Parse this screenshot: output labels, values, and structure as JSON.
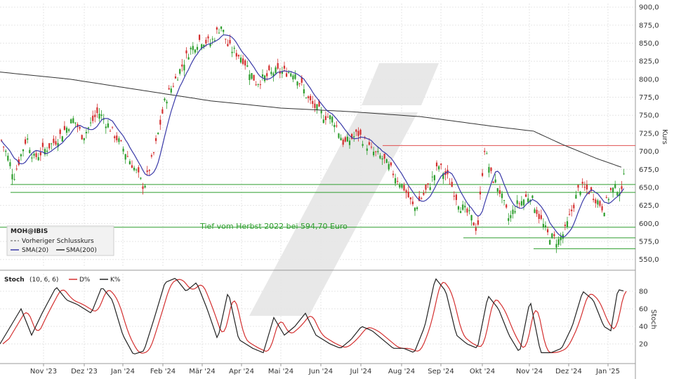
{
  "chart_data": [
    {
      "type": "candlestick",
      "ylabel": "Kurs",
      "ylim": [
        540,
        905
      ],
      "yticks": [
        550,
        575,
        600,
        625,
        650,
        675,
        700,
        725,
        750,
        775,
        800,
        825,
        850,
        875,
        900
      ],
      "ytick_labels": [
        "550,0",
        "575,0",
        "600,0",
        "625,0",
        "650,0",
        "675,0",
        "700,0",
        "725,0",
        "750,0",
        "775,0",
        "800,0",
        "825,0",
        "850,0",
        "875,0",
        "900,0"
      ],
      "x_months": [
        "Nov '23",
        "Dez '23",
        "Jan '24",
        "Feb '24",
        "Mär '24",
        "Apr '24",
        "Mai '24",
        "Jun '24",
        "Jul '24",
        "Aug '24",
        "Sep '24",
        "Okt '24",
        "Nov '24",
        "Dez '24",
        "Jan '25"
      ],
      "close_anchors": [
        [
          0,
          720
        ],
        [
          12,
          690
        ],
        [
          20,
          665
        ],
        [
          38,
          720
        ],
        [
          48,
          690
        ],
        [
          80,
          715
        ],
        [
          105,
          745
        ],
        [
          118,
          720
        ],
        [
          140,
          755
        ],
        [
          155,
          735
        ],
        [
          175,
          705
        ],
        [
          195,
          670
        ],
        [
          205,
          650
        ],
        [
          220,
          700
        ],
        [
          235,
          770
        ],
        [
          255,
          810
        ],
        [
          270,
          840
        ],
        [
          285,
          855
        ],
        [
          300,
          850
        ],
        [
          315,
          875
        ],
        [
          325,
          845
        ],
        [
          345,
          830
        ],
        [
          365,
          795
        ],
        [
          390,
          810
        ],
        [
          420,
          810
        ],
        [
          440,
          770
        ],
        [
          460,
          750
        ],
        [
          475,
          745
        ],
        [
          490,
          710
        ],
        [
          510,
          725
        ],
        [
          530,
          700
        ],
        [
          545,
          690
        ],
        [
          560,
          670
        ],
        [
          575,
          650
        ],
        [
          590,
          620
        ],
        [
          610,
          650
        ],
        [
          625,
          680
        ],
        [
          640,
          660
        ],
        [
          655,
          625
        ],
        [
          670,
          610
        ],
        [
          680,
          590
        ],
        [
          690,
          705
        ],
        [
          700,
          665
        ],
        [
          710,
          650
        ],
        [
          725,
          605
        ],
        [
          735,
          625
        ],
        [
          755,
          640
        ],
        [
          770,
          605
        ],
        [
          780,
          585
        ],
        [
          795,
          575
        ],
        [
          805,
          590
        ],
        [
          815,
          620
        ],
        [
          825,
          650
        ],
        [
          840,
          645
        ],
        [
          860,
          620
        ],
        [
          870,
          645
        ],
        [
          880,
          650
        ],
        [
          886,
          640
        ],
        [
          890,
          695
        ]
      ],
      "annotation": "Tief vom Herbst 2022 bei 594,70 Euro",
      "horizontal_lines": [
        {
          "value": 708,
          "color": "#e05050"
        },
        {
          "value": 654,
          "color": "#2e9e2e"
        },
        {
          "value": 643,
          "color": "#2e9e2e"
        },
        {
          "value": 594.7,
          "color": "#2e9e2e"
        },
        {
          "value": 580,
          "color": "#2e9e2e"
        },
        {
          "value": 565,
          "color": "#2e9e2e"
        }
      ],
      "legend": {
        "title": "MOH@IBIS",
        "items": [
          "Vorheriger Schlusskurs",
          "SMA(20)",
          "SMA(200)"
        ]
      },
      "colors": {
        "up": "#2e9e2e",
        "down": "#d43030",
        "sma20": "#3a3aa8",
        "sma200": "#333333"
      }
    },
    {
      "type": "line",
      "title": "Stoch",
      "params": "(10, 6, 6)",
      "ylabel": "Stoch",
      "ylim": [
        0,
        100
      ],
      "yticks": [
        20,
        40,
        60,
        80
      ],
      "series": [
        {
          "name": "D%",
          "color": "#d43030"
        },
        {
          "name": "K%",
          "color": "#222222"
        }
      ],
      "k_anchors": [
        [
          0,
          20
        ],
        [
          15,
          40
        ],
        [
          30,
          60
        ],
        [
          45,
          30
        ],
        [
          60,
          55
        ],
        [
          80,
          85
        ],
        [
          95,
          70
        ],
        [
          110,
          65
        ],
        [
          130,
          55
        ],
        [
          145,
          85
        ],
        [
          160,
          70
        ],
        [
          175,
          30
        ],
        [
          190,
          8
        ],
        [
          205,
          12
        ],
        [
          220,
          50
        ],
        [
          235,
          90
        ],
        [
          250,
          95
        ],
        [
          265,
          80
        ],
        [
          280,
          90
        ],
        [
          295,
          60
        ],
        [
          310,
          25
        ],
        [
          325,
          80
        ],
        [
          340,
          25
        ],
        [
          360,
          15
        ],
        [
          375,
          10
        ],
        [
          390,
          50
        ],
        [
          405,
          30
        ],
        [
          420,
          40
        ],
        [
          435,
          55
        ],
        [
          450,
          30
        ],
        [
          470,
          20
        ],
        [
          485,
          15
        ],
        [
          500,
          25
        ],
        [
          515,
          40
        ],
        [
          530,
          35
        ],
        [
          545,
          25
        ],
        [
          560,
          15
        ],
        [
          575,
          15
        ],
        [
          590,
          10
        ],
        [
          605,
          40
        ],
        [
          620,
          95
        ],
        [
          635,
          80
        ],
        [
          650,
          30
        ],
        [
          665,
          20
        ],
        [
          680,
          15
        ],
        [
          695,
          75
        ],
        [
          710,
          60
        ],
        [
          725,
          30
        ],
        [
          740,
          10
        ],
        [
          755,
          70
        ],
        [
          770,
          10
        ],
        [
          785,
          10
        ],
        [
          800,
          15
        ],
        [
          815,
          40
        ],
        [
          830,
          80
        ],
        [
          845,
          70
        ],
        [
          860,
          40
        ],
        [
          870,
          35
        ],
        [
          880,
          82
        ],
        [
          890,
          80
        ]
      ]
    }
  ]
}
